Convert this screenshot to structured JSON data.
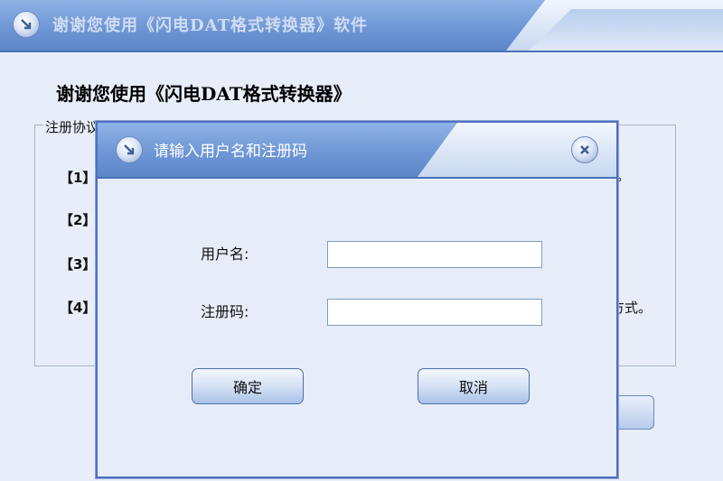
{
  "main_window": {
    "title": "谢谢您使用《闪电DAT格式转换器》软件",
    "welcome_heading": "谢谢您使用《闪电DAT格式转换器》",
    "agreement_legend": "注册协议",
    "clauses": [
      {
        "num": "【1】",
        "tail": "。"
      },
      {
        "num": "【2】",
        "tail": ""
      },
      {
        "num": "【3】",
        "tail": ""
      },
      {
        "num": "【4】",
        "tail": "方式。"
      }
    ]
  },
  "dialog": {
    "title": "请输入用户名和注册码",
    "username_label": "用户名:",
    "username_value": "",
    "regcode_label": "注册码:",
    "regcode_value": "",
    "ok_label": "确定",
    "cancel_label": "取消"
  },
  "colors": {
    "titlebar": "#6f97d6",
    "dialog_border": "#4f6fc0",
    "background": "#e7eef9"
  },
  "icons": {
    "main_title_icon": "arrow-circle-icon",
    "dialog_title_icon": "arrow-circle-icon",
    "dialog_close_icon": "close-icon"
  }
}
